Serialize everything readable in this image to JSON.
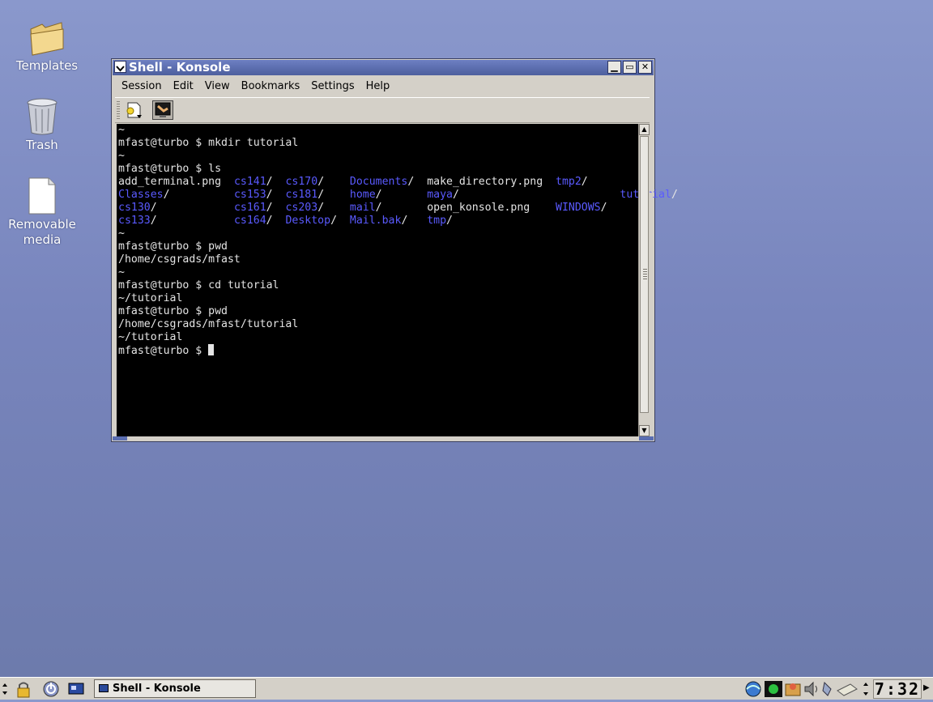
{
  "desktop": {
    "icons": [
      {
        "label": "Templates"
      },
      {
        "label": "Trash"
      },
      {
        "label": "Removable\nmedia"
      }
    ]
  },
  "window": {
    "title": "Shell - Konsole",
    "buttons": {
      "minimize": "▁",
      "maximize": "▭",
      "close": "✕"
    }
  },
  "menubar": {
    "items": [
      "Session",
      "Edit",
      "View",
      "Bookmarks",
      "Settings",
      "Help"
    ]
  },
  "terminal": {
    "prompt": "mfast@turbo $ ",
    "lines": [
      {
        "t": "plain",
        "text": "~"
      },
      {
        "t": "plain",
        "text": "mfast@turbo $ mkdir tutorial"
      },
      {
        "t": "plain",
        "text": "~"
      },
      {
        "t": "plain",
        "text": "mfast@turbo $ ls"
      },
      {
        "t": "ls",
        "cols": [
          {
            "name": "add_terminal.png",
            "dir": false
          },
          {
            "name": "cs141",
            "dir": true
          },
          {
            "name": "cs170",
            "dir": true
          },
          {
            "name": "Documents",
            "dir": true
          },
          {
            "name": "make_directory.png",
            "dir": false
          },
          {
            "name": "tmp2",
            "dir": true
          }
        ]
      },
      {
        "t": "ls",
        "cols": [
          {
            "name": "Classes",
            "dir": true
          },
          {
            "name": "cs153",
            "dir": true
          },
          {
            "name": "cs181",
            "dir": true
          },
          {
            "name": "home",
            "dir": true
          },
          {
            "name": "maya",
            "dir": true
          },
          {
            "name": "",
            "dir": false
          },
          {
            "name": "tutorial",
            "dir": true
          }
        ]
      },
      {
        "t": "ls",
        "cols": [
          {
            "name": "cs130",
            "dir": true
          },
          {
            "name": "cs161",
            "dir": true
          },
          {
            "name": "cs203",
            "dir": true
          },
          {
            "name": "mail",
            "dir": true
          },
          {
            "name": "open_konsole.png",
            "dir": false
          },
          {
            "name": "WINDOWS",
            "dir": true
          }
        ]
      },
      {
        "t": "ls",
        "cols": [
          {
            "name": "cs133",
            "dir": true
          },
          {
            "name": "cs164",
            "dir": true
          },
          {
            "name": "Desktop",
            "dir": true
          },
          {
            "name": "Mail.bak",
            "dir": true
          },
          {
            "name": "tmp",
            "dir": true
          }
        ]
      },
      {
        "t": "plain",
        "text": "~"
      },
      {
        "t": "plain",
        "text": "mfast@turbo $ pwd"
      },
      {
        "t": "plain",
        "text": "/home/csgrads/mfast"
      },
      {
        "t": "plain",
        "text": "~"
      },
      {
        "t": "plain",
        "text": "mfast@turbo $ cd tutorial"
      },
      {
        "t": "plain",
        "text": "~/tutorial"
      },
      {
        "t": "plain",
        "text": "mfast@turbo $ pwd"
      },
      {
        "t": "plain",
        "text": "/home/csgrads/mfast/tutorial"
      },
      {
        "t": "plain",
        "text": "~/tutorial"
      },
      {
        "t": "prompt",
        "text": "mfast@turbo $ "
      }
    ]
  },
  "taskbar": {
    "task_label": "Shell - Konsole",
    "clock": "7:32"
  },
  "colors": {
    "desktop": "#7f8cc4",
    "titlebar": "#5a6db0",
    "dir_text": "#5a5aff",
    "terminal_bg": "#000000"
  }
}
